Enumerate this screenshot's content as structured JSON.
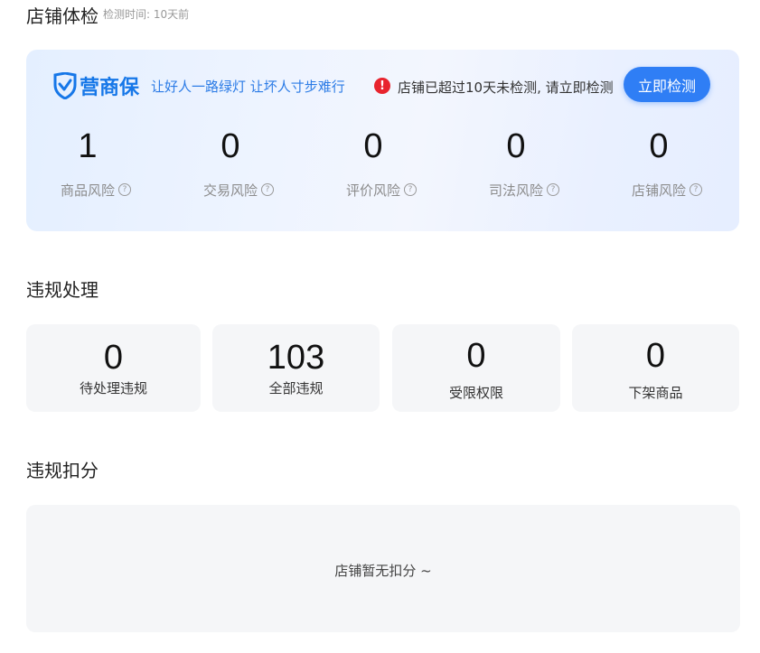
{
  "header": {
    "title": "店铺体检",
    "check_time": "检测时间: 10天前"
  },
  "health_card": {
    "brand_name": "营商保",
    "slogan": "让好人一路绿灯 让坏人寸步难行",
    "warning_icon_glyph": "!",
    "warning_text": "店铺已超过10天未检测, 请立即检测",
    "check_button_label": "立即检测",
    "help_glyph": "?",
    "risks": [
      {
        "value": "1",
        "label": "商品风险"
      },
      {
        "value": "0",
        "label": "交易风险"
      },
      {
        "value": "0",
        "label": "评价风险"
      },
      {
        "value": "0",
        "label": "司法风险"
      },
      {
        "value": "0",
        "label": "店铺风险"
      }
    ],
    "colors": {
      "brand": "#1677e8",
      "button": "#2f7ef5",
      "warning": "#e8242e"
    }
  },
  "violations": {
    "title": "违规处理",
    "cards": [
      {
        "value": "0",
        "label": "待处理违规"
      },
      {
        "value": "103",
        "label": "全部违规"
      },
      {
        "value": "0",
        "label": "受限权限"
      },
      {
        "value": "0",
        "label": "下架商品"
      }
    ]
  },
  "deductions": {
    "title": "违规扣分",
    "empty_text": "店铺暂无扣分 ~"
  },
  "icons": [
    "shield-logo-icon",
    "warning-icon",
    "help-icon"
  ]
}
